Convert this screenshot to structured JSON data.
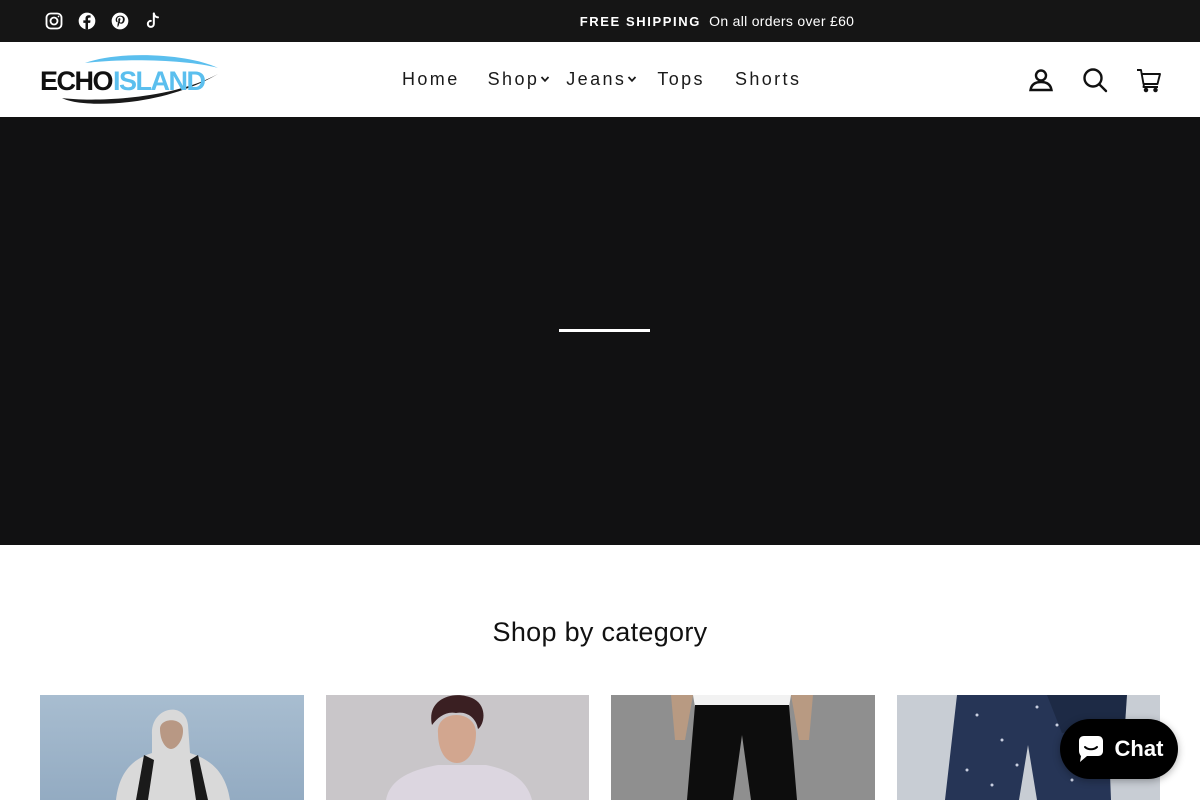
{
  "announcement": {
    "strong": "FREE SHIPPING",
    "text": "On all orders over £60"
  },
  "social_icons": [
    "instagram-icon",
    "facebook-icon",
    "pinterest-icon",
    "tiktok-icon"
  ],
  "header": {
    "logo_alt": "ECHOISLAND",
    "nav": [
      {
        "label": "Home",
        "has_dropdown": false
      },
      {
        "label": "Shop",
        "has_dropdown": true
      },
      {
        "label": "Jeans",
        "has_dropdown": true
      },
      {
        "label": "Tops",
        "has_dropdown": false
      },
      {
        "label": "Shorts",
        "has_dropdown": false
      }
    ],
    "icons": [
      "account-icon",
      "search-icon",
      "cart-icon"
    ]
  },
  "hero": {
    "slide_progress": 0.33
  },
  "categories": {
    "title": "Shop by category",
    "items": [
      "hoodie-model",
      "tshirt-model",
      "jeans-model",
      "patterned-trousers-model"
    ]
  },
  "chat": {
    "label": "Chat"
  },
  "colors": {
    "announcement_bg": "#151515",
    "hero_bg": "#111112",
    "logo_blue": "#5bbfee",
    "chat_bg": "#000000"
  }
}
